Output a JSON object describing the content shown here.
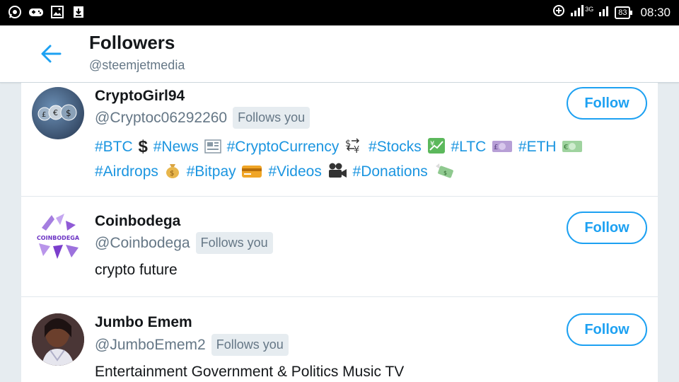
{
  "status_bar": {
    "battery": "83",
    "network": "3G",
    "time": "08:30"
  },
  "header": {
    "title": "Followers",
    "subtitle": "@steemjetmedia"
  },
  "colors": {
    "accent": "#1da1f2",
    "hashtag": "#1b95e0",
    "muted": "#657786",
    "text": "#14171a"
  },
  "followers": [
    {
      "name": "CryptoGirl94",
      "handle": "@Cryptoc06292260",
      "follows_you": "Follows you",
      "follow_label": "Follow",
      "bio": {
        "line1": [
          "#BTC",
          "#News",
          "#CryptoCurrency",
          "#Stocks",
          "#LTC",
          "#ETH"
        ],
        "line2": [
          "#Airdrops",
          "#Bitpay",
          "#Videos",
          "#Donations"
        ]
      }
    },
    {
      "name": "Coinbodega",
      "handle": "@Coinbodega",
      "follows_you": "Follows you",
      "follow_label": "Follow",
      "bio_text": "crypto future",
      "avatar_text": "COINBODEGA"
    },
    {
      "name": "Jumbo Emem",
      "handle": "@JumboEmem2",
      "follows_you": "Follows you",
      "follow_label": "Follow",
      "bio_text": "Entertainment Government & Politics Music TV"
    }
  ]
}
